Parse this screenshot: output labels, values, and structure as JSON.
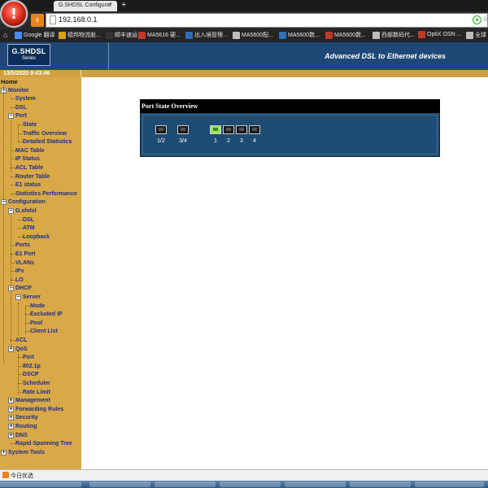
{
  "browser": {
    "tab_title": "G.SHDSL Configurat",
    "tab_close": "×",
    "new_tab": "+",
    "url": "192.168.0.1",
    "bookmarks": [
      {
        "label": "Google 翻译",
        "color": "#4a8af4"
      },
      {
        "label": "德邦物流股...",
        "color": "#d4a017"
      },
      {
        "label": "顺丰速运",
        "color": "#333333"
      },
      {
        "label": "MA5616 硬...",
        "color": "#c0392b"
      },
      {
        "label": "出入境管理...",
        "color": "#2e6fb5"
      },
      {
        "label": "MA5600配...",
        "color": "#bdbdbd"
      },
      {
        "label": "MA5600数...",
        "color": "#2e6fb5"
      },
      {
        "label": "MA5600数...",
        "color": "#c0392b"
      },
      {
        "label": "西部数码代...",
        "color": "#bdbdbd"
      },
      {
        "label": "OptiX OSN ...",
        "color": "#c0392b"
      },
      {
        "label": "全球",
        "color": "#bdbdbd"
      }
    ]
  },
  "app": {
    "logo_title": "G.SHDSL",
    "logo_sub": "Series",
    "tagline": "Advanced DSL to Ethernet devices",
    "datetime": "13/5/2020 9:43:46"
  },
  "nav": [
    {
      "label": "Home",
      "level": 0,
      "toggle": ""
    },
    {
      "label": "Monitor",
      "level": 0,
      "toggle": "−"
    },
    {
      "label": "System",
      "level": 1,
      "toggle": ""
    },
    {
      "label": "DSL",
      "level": 1,
      "toggle": ""
    },
    {
      "label": "Port",
      "level": 1,
      "toggle": "−"
    },
    {
      "label": "State",
      "level": 2,
      "toggle": ""
    },
    {
      "label": "Traffic Overview",
      "level": 2,
      "toggle": ""
    },
    {
      "label": "Detailed Statistics",
      "level": 2,
      "toggle": ""
    },
    {
      "label": "MAC Table",
      "level": 1,
      "toggle": ""
    },
    {
      "label": "IP Status",
      "level": 1,
      "toggle": ""
    },
    {
      "label": "ACL Table",
      "level": 1,
      "toggle": ""
    },
    {
      "label": "Router Table",
      "level": 1,
      "toggle": ""
    },
    {
      "label": "E1 status",
      "level": 1,
      "toggle": ""
    },
    {
      "label": "Statistics Performance",
      "level": 1,
      "toggle": ""
    },
    {
      "label": "Configuration",
      "level": 0,
      "toggle": "−"
    },
    {
      "label": "G.shdsl",
      "level": 1,
      "toggle": "−"
    },
    {
      "label": "DSL",
      "level": 2,
      "toggle": ""
    },
    {
      "label": "ATM",
      "level": 2,
      "toggle": ""
    },
    {
      "label": "Loopback",
      "level": 2,
      "toggle": ""
    },
    {
      "label": "Ports",
      "level": 1,
      "toggle": ""
    },
    {
      "label": "E1 Port",
      "level": 1,
      "toggle": ""
    },
    {
      "label": "VLANs",
      "level": 1,
      "toggle": ""
    },
    {
      "label": "IPs",
      "level": 1,
      "toggle": ""
    },
    {
      "label": "LO",
      "level": 1,
      "toggle": ""
    },
    {
      "label": "DHCP",
      "level": 1,
      "toggle": "−"
    },
    {
      "label": "Server",
      "level": 2,
      "toggle": "−"
    },
    {
      "label": "Mode",
      "level": 3,
      "toggle": ""
    },
    {
      "label": "Excluded IP",
      "level": 3,
      "toggle": ""
    },
    {
      "label": "Pool",
      "level": 3,
      "toggle": ""
    },
    {
      "label": "Client List",
      "level": 3,
      "toggle": ""
    },
    {
      "label": "ACL",
      "level": 1,
      "toggle": ""
    },
    {
      "label": "QoS",
      "level": 1,
      "toggle": "−"
    },
    {
      "label": "Port",
      "level": 2,
      "toggle": ""
    },
    {
      "label": "802.1p",
      "level": 2,
      "toggle": ""
    },
    {
      "label": "DSCP",
      "level": 2,
      "toggle": ""
    },
    {
      "label": "Scheduler",
      "level": 2,
      "toggle": ""
    },
    {
      "label": "Rate Limit",
      "level": 2,
      "toggle": ""
    },
    {
      "label": "Management",
      "level": 1,
      "toggle": "+"
    },
    {
      "label": "Forwarding Rules",
      "level": 1,
      "toggle": "+"
    },
    {
      "label": "Security",
      "level": 1,
      "toggle": "+"
    },
    {
      "label": "Routing",
      "level": 1,
      "toggle": "+"
    },
    {
      "label": "DNS",
      "level": 1,
      "toggle": "+"
    },
    {
      "label": "Rapid Spanning Tree",
      "level": 1,
      "toggle": ""
    },
    {
      "label": "System Tools",
      "level": 0,
      "toggle": "+"
    }
  ],
  "panel": {
    "title": "Port State Overview",
    "ports": [
      {
        "label": "1/2",
        "active": false
      },
      {
        "label": "3/4",
        "active": false
      },
      {
        "label": "1",
        "active": true
      },
      {
        "label": "2",
        "active": false
      },
      {
        "label": "3",
        "active": false
      },
      {
        "label": "4",
        "active": false
      }
    ]
  },
  "status": {
    "text": "今日优选"
  },
  "colors": {
    "header_blue": "#1f4877",
    "sidebar_gold": "#d9a947",
    "link_blue": "#1d2e8a",
    "port_active": "#9fe35f"
  }
}
